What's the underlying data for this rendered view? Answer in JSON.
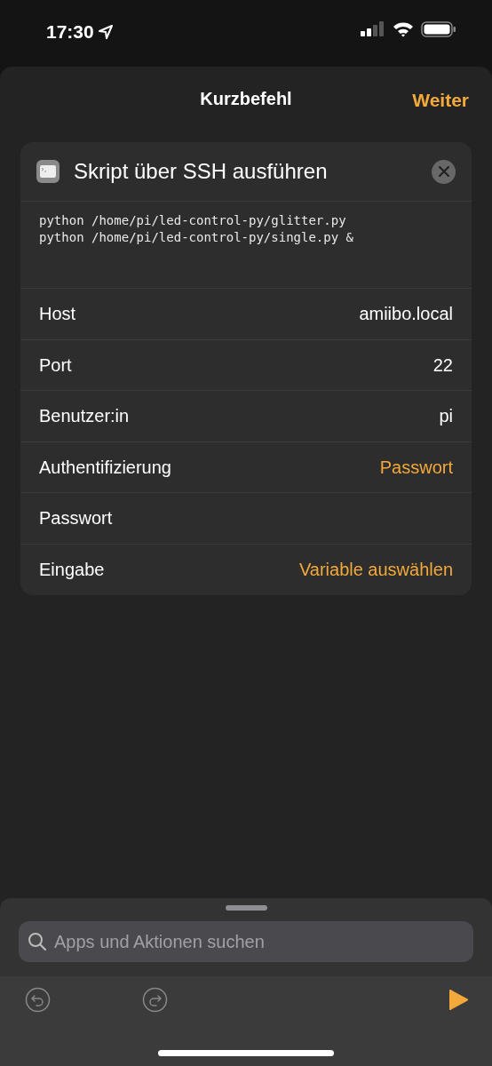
{
  "status_bar": {
    "time": "17:30"
  },
  "header": {
    "title": "Kurzbefehl",
    "action": "Weiter"
  },
  "action_card": {
    "title": "Skript über SSH ausführen",
    "script_lines": [
      "python /home/pi/led-control-py/glitter.py",
      "python /home/pi/led-control-py/single.py &"
    ],
    "rows": [
      {
        "label": "Host",
        "value": "amiibo.local",
        "kind": "text"
      },
      {
        "label": "Port",
        "value": "22",
        "kind": "text"
      },
      {
        "label": "Benutzer:in",
        "value": "pi",
        "kind": "text"
      },
      {
        "label": "Authentifizierung",
        "value": "Passwort",
        "kind": "choice"
      },
      {
        "label": "Passwort",
        "kind": "empty"
      },
      {
        "label": "Eingabe",
        "value": "Variable auswählen",
        "kind": "choice"
      }
    ]
  },
  "search": {
    "placeholder": "Apps und Aktionen suchen"
  }
}
